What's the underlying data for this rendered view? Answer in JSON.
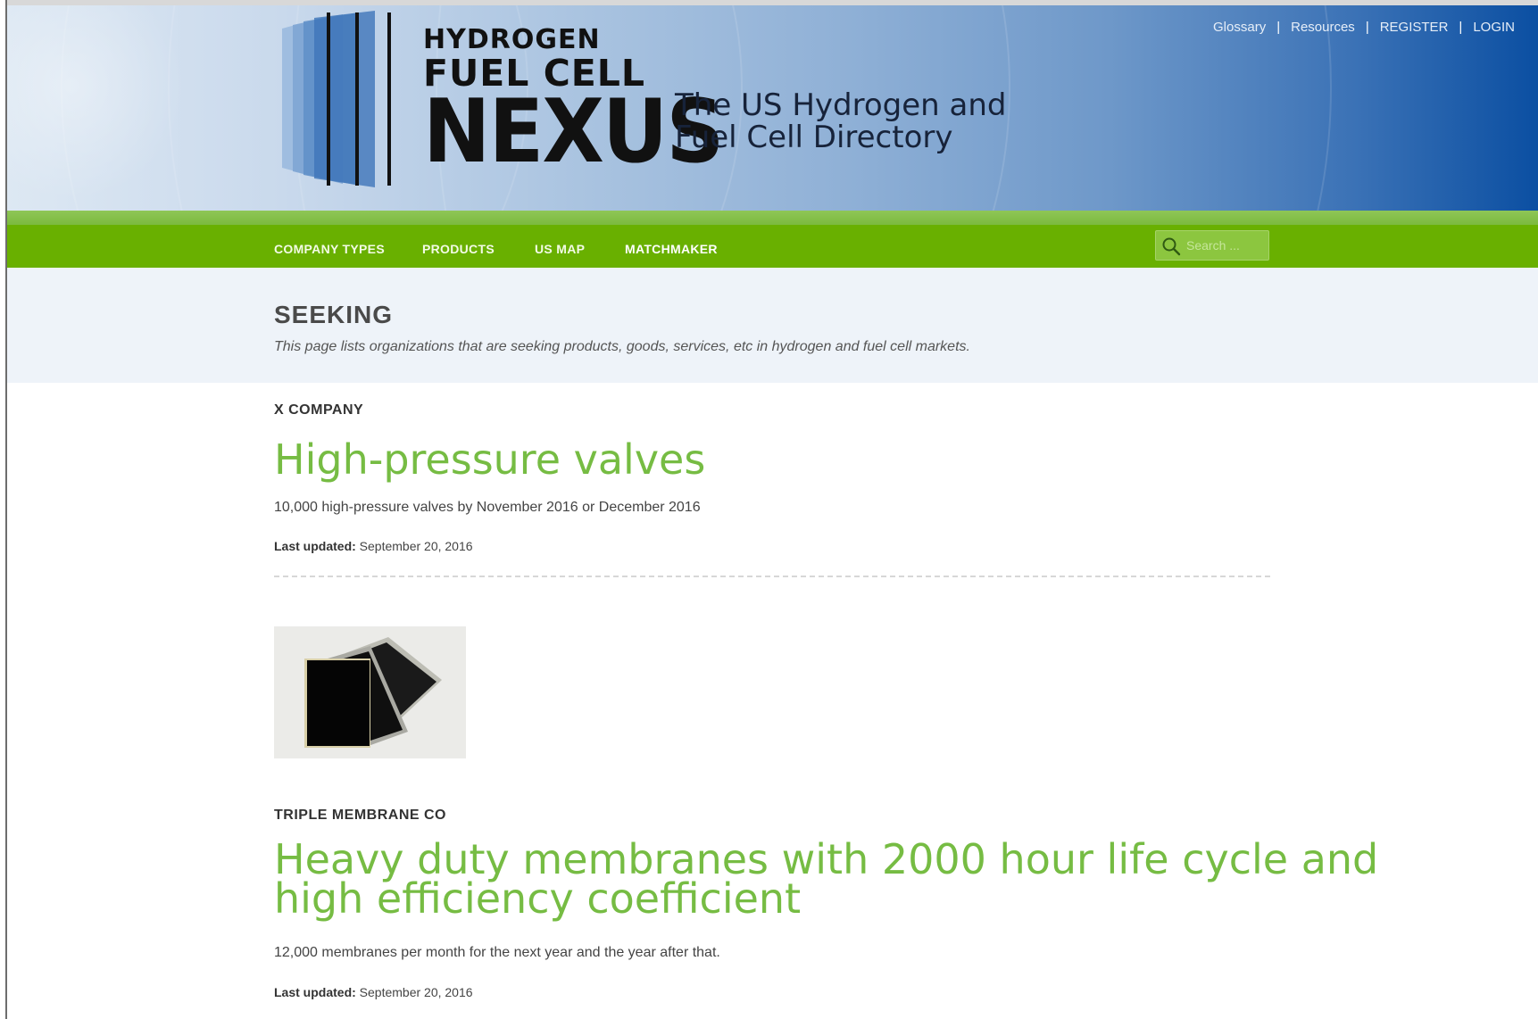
{
  "header": {
    "logo_line1": "HYDROGEN",
    "logo_line2": "FUEL CELL",
    "logo_line3": "NEXUS",
    "tagline_line1": "The US Hydrogen and",
    "tagline_line2": "Fuel Cell Directory",
    "top_links": [
      "Glossary",
      "Resources",
      "REGISTER",
      "LOGIN"
    ],
    "top_links_separator": "|"
  },
  "nav": {
    "items": [
      "COMPANY TYPES",
      "PRODUCTS",
      "US MAP",
      "MATCHMAKER"
    ],
    "search_placeholder": "Search ..."
  },
  "page": {
    "title": "SEEKING",
    "description": "This page lists organizations that are seeking products, goods, services, etc in hydrogen and fuel cell markets."
  },
  "listings": [
    {
      "company": "X COMPANY",
      "title": "High-pressure valves",
      "description": "10,000 high-pressure valves by November 2016 or December 2016",
      "updated_label": "Last updated:",
      "updated_date": "September 20, 2016"
    },
    {
      "company": "TRIPLE MEMBRANE CO",
      "title_line1": "Heavy duty membranes with 2000 hour life cycle and",
      "title_line2": "high efficiency coefficient",
      "description": "12,000 membranes per month for the next year and the year after that.",
      "updated_label": "Last updated:",
      "updated_date": "September 20, 2016"
    }
  ],
  "colors": {
    "nav_green": "#69b000",
    "title_green": "#76bc43",
    "header_blue": "#0b4fa2"
  },
  "icons": [
    "search-icon",
    "membrane-image"
  ]
}
